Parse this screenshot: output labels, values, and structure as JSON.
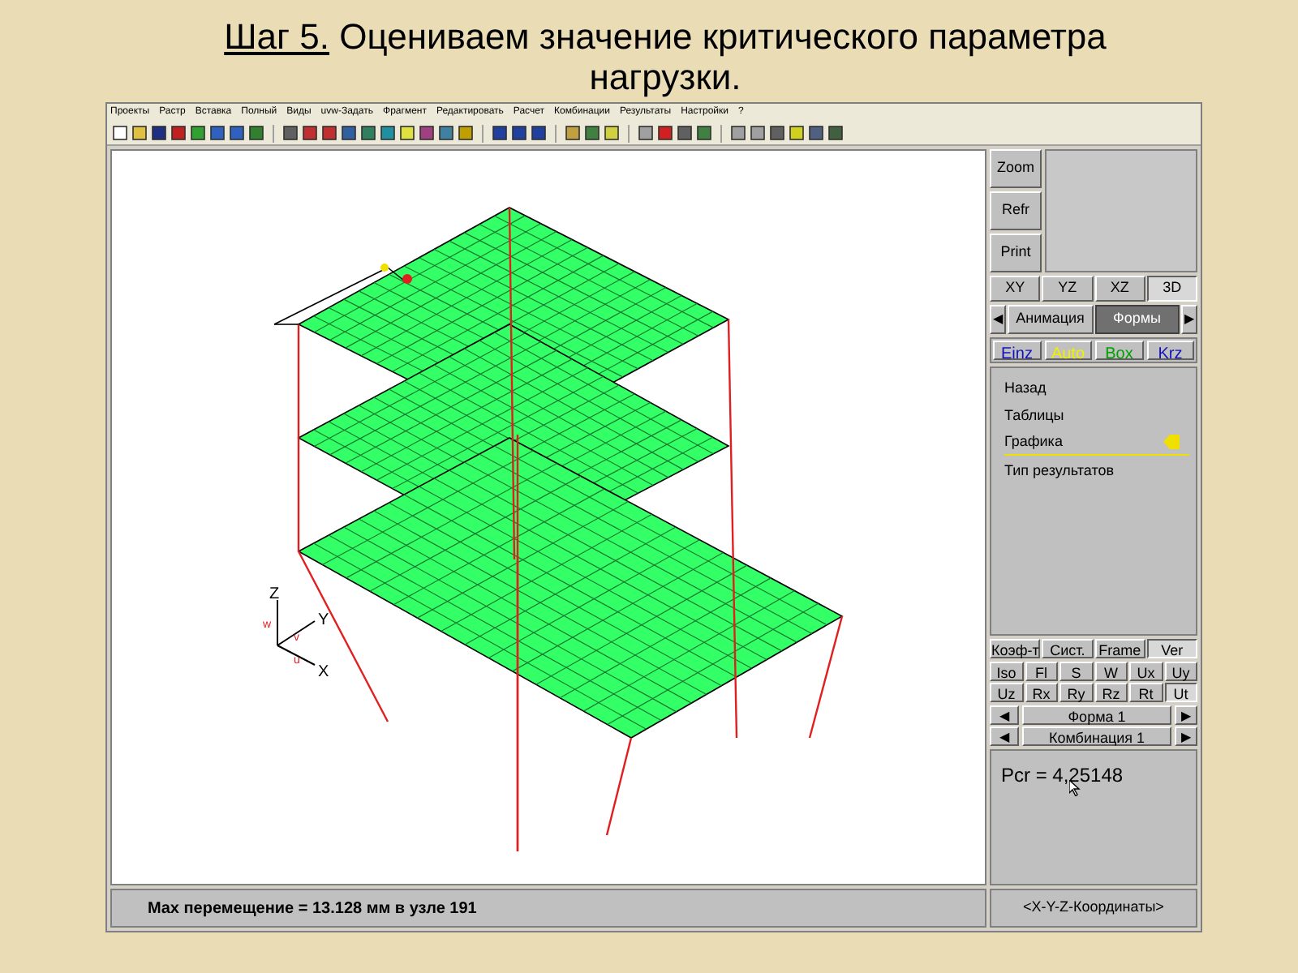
{
  "slide": {
    "step_label": "Шаг 5.",
    "title": "Оцениваем значение критического параметра нагрузки."
  },
  "menu": [
    "Проекты",
    "Растр",
    "Вставка",
    "Полный",
    "Виды",
    "uvw-Задать",
    "Фрагмент",
    "Редактировать",
    "Расчет",
    "Комбинации",
    "Результаты",
    "Настройки",
    "?"
  ],
  "axes": {
    "z": "Z",
    "y": "Y",
    "x": "X",
    "w": "w",
    "v": "v",
    "u": "u"
  },
  "side_buttons": [
    "Zoom",
    "Refr",
    "Print"
  ],
  "view_tabs": [
    {
      "label": "XY",
      "selected": false
    },
    {
      "label": "YZ",
      "selected": false
    },
    {
      "label": "XZ",
      "selected": false
    },
    {
      "label": "3D",
      "selected": true
    }
  ],
  "mode_tabs": {
    "prev": "◀",
    "next": "▶",
    "items": [
      {
        "label": "Анимация",
        "selected": false
      },
      {
        "label": "Формы",
        "selected": true
      }
    ]
  },
  "filters": [
    {
      "label": "Einz",
      "color": "#1010c0"
    },
    {
      "label": "Auto",
      "color": "#f0f000"
    },
    {
      "label": "Box",
      "color": "#00a000"
    },
    {
      "label": "Krz",
      "color": "#1010c0"
    }
  ],
  "menu_list": [
    {
      "label": "Назад",
      "selected": false
    },
    {
      "label": "Таблицы",
      "selected": false
    },
    {
      "label": "Графика",
      "selected": true
    },
    {
      "label": "Тип результатов",
      "selected": false
    }
  ],
  "result_tabs": [
    {
      "label": "Коэф-т",
      "selected": false
    },
    {
      "label": "Сист.",
      "selected": false
    },
    {
      "label": "Frame",
      "selected": false
    },
    {
      "label": "Ver",
      "selected": true
    }
  ],
  "components": [
    {
      "label": "Iso",
      "selected": false
    },
    {
      "label": "Fl",
      "selected": false
    },
    {
      "label": "S",
      "selected": false
    },
    {
      "label": "W",
      "selected": false
    },
    {
      "label": "Ux",
      "selected": false
    },
    {
      "label": "Uy",
      "selected": false
    },
    {
      "label": "Uz",
      "selected": false
    },
    {
      "label": "Rx",
      "selected": false
    },
    {
      "label": "Ry",
      "selected": false
    },
    {
      "label": "Rz",
      "selected": false
    },
    {
      "label": "Rt",
      "selected": false
    },
    {
      "label": "Ut",
      "selected": true
    }
  ],
  "selectors": [
    {
      "prev": "◀",
      "value": "Форма  1",
      "next": "▶"
    },
    {
      "prev": "◀",
      "value": "Комбинация 1",
      "next": "▶"
    }
  ],
  "result": "Pcr = 4,25148",
  "status": "Max перемещение  = 13.128 мм в узле 191",
  "coords_button": "<X-Y-Z-Координаты>"
}
